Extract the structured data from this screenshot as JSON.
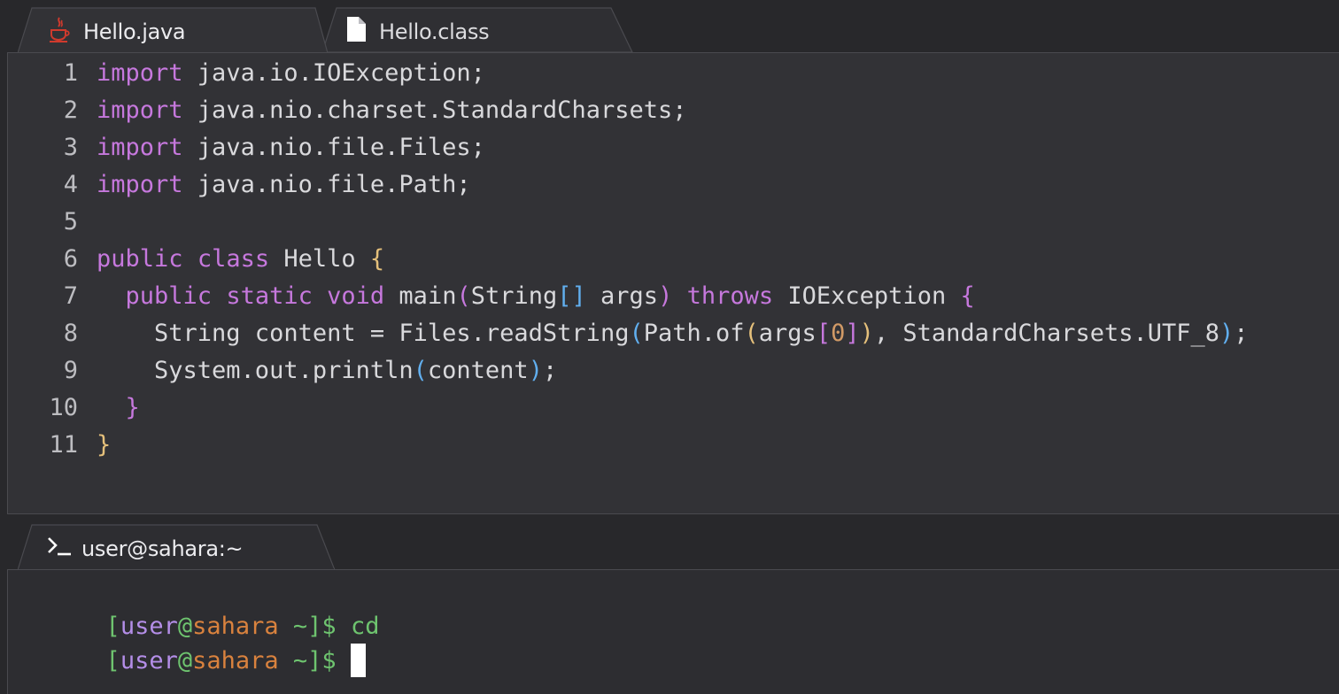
{
  "editor": {
    "tabs": [
      {
        "label": "Hello.java",
        "icon": "java-icon",
        "active": true
      },
      {
        "label": "Hello.class",
        "icon": "file-icon",
        "active": false
      }
    ],
    "lines": [
      {
        "number": "1",
        "tokens": [
          {
            "t": "import",
            "c": "kw"
          },
          {
            "t": " java.io.IOException;",
            "c": ""
          }
        ]
      },
      {
        "number": "2",
        "tokens": [
          {
            "t": "import",
            "c": "kw"
          },
          {
            "t": " java.nio.charset.StandardCharsets;",
            "c": ""
          }
        ]
      },
      {
        "number": "3",
        "tokens": [
          {
            "t": "import",
            "c": "kw"
          },
          {
            "t": " java.nio.file.Files;",
            "c": ""
          }
        ]
      },
      {
        "number": "4",
        "tokens": [
          {
            "t": "import",
            "c": "kw"
          },
          {
            "t": " java.nio.file.Path;",
            "c": ""
          }
        ]
      },
      {
        "number": "5",
        "tokens": []
      },
      {
        "number": "6",
        "tokens": [
          {
            "t": "public",
            "c": "kw"
          },
          {
            "t": " ",
            "c": ""
          },
          {
            "t": "class",
            "c": "kw"
          },
          {
            "t": " Hello ",
            "c": ""
          },
          {
            "t": "{",
            "c": "br-y"
          }
        ]
      },
      {
        "number": "7",
        "tokens": [
          {
            "t": "  ",
            "c": ""
          },
          {
            "t": "public",
            "c": "kw"
          },
          {
            "t": " ",
            "c": ""
          },
          {
            "t": "static",
            "c": "kw"
          },
          {
            "t": " ",
            "c": ""
          },
          {
            "t": "void",
            "c": "kw"
          },
          {
            "t": " main",
            "c": ""
          },
          {
            "t": "(",
            "c": "br-p"
          },
          {
            "t": "String",
            "c": ""
          },
          {
            "t": "[]",
            "c": "br-b"
          },
          {
            "t": " args",
            "c": ""
          },
          {
            "t": ")",
            "c": "br-p"
          },
          {
            "t": " ",
            "c": ""
          },
          {
            "t": "throws",
            "c": "kw"
          },
          {
            "t": " IOException ",
            "c": ""
          },
          {
            "t": "{",
            "c": "br-p"
          }
        ]
      },
      {
        "number": "8",
        "tokens": [
          {
            "t": "    String content = Files.readString",
            "c": ""
          },
          {
            "t": "(",
            "c": "br-b"
          },
          {
            "t": "Path.of",
            "c": ""
          },
          {
            "t": "(",
            "c": "br-y"
          },
          {
            "t": "args",
            "c": ""
          },
          {
            "t": "[",
            "c": "br-p"
          },
          {
            "t": "0",
            "c": "num"
          },
          {
            "t": "]",
            "c": "br-p"
          },
          {
            "t": ")",
            "c": "br-y"
          },
          {
            "t": ", StandardCharsets.UTF_8",
            "c": ""
          },
          {
            "t": ")",
            "c": "br-b"
          },
          {
            "t": ";",
            "c": ""
          }
        ]
      },
      {
        "number": "9",
        "tokens": [
          {
            "t": "    System.out.println",
            "c": ""
          },
          {
            "t": "(",
            "c": "br-b"
          },
          {
            "t": "content",
            "c": ""
          },
          {
            "t": ")",
            "c": "br-b"
          },
          {
            "t": ";",
            "c": ""
          }
        ]
      },
      {
        "number": "10",
        "tokens": [
          {
            "t": "  ",
            "c": ""
          },
          {
            "t": "}",
            "c": "br-p"
          }
        ]
      },
      {
        "number": "11",
        "tokens": [
          {
            "t": "}",
            "c": "br-y"
          }
        ]
      }
    ]
  },
  "terminal": {
    "tab": {
      "label": "user@sahara:~",
      "icon": "terminal-icon"
    },
    "prompt": {
      "open": "[",
      "user": "user",
      "at": "@",
      "host": "sahara",
      "path": " ~",
      "close": "]$ "
    },
    "lines": [
      {
        "command": "cd",
        "cursor": false
      },
      {
        "command": "",
        "cursor": true
      }
    ]
  },
  "colors": {
    "keyword": "#c678dd",
    "brace_yellow": "#e5c07b",
    "brace_blue": "#61afef",
    "number": "#d19a66",
    "prompt_green": "#6ec46f",
    "prompt_user": "#b48ee8",
    "prompt_host": "#d9823e",
    "java_icon": "#d03a2d"
  }
}
